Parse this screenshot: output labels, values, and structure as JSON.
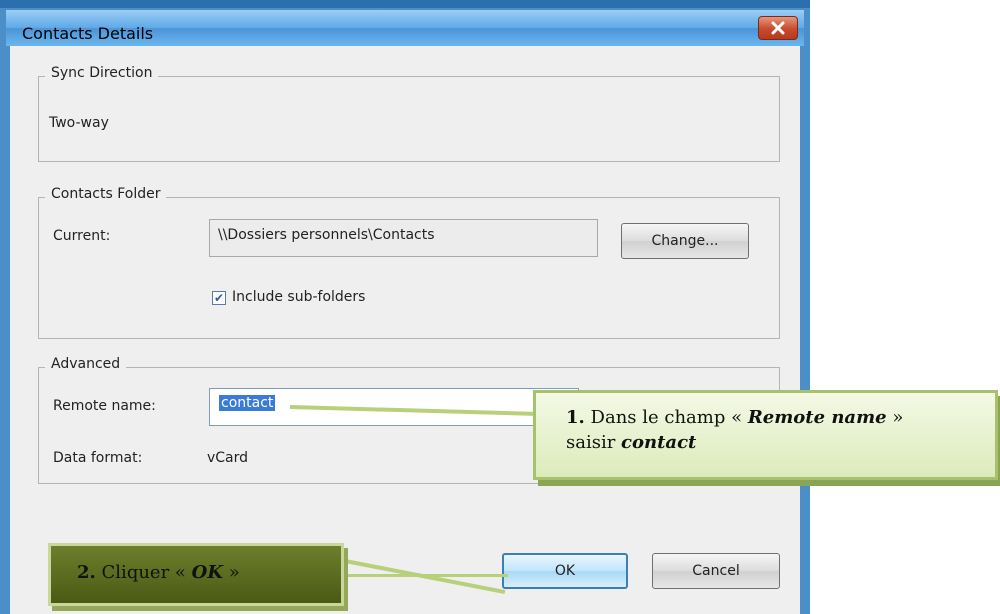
{
  "window": {
    "title": "Contacts Details",
    "close_symbol": "✕"
  },
  "sync_direction": {
    "legend": "Sync Direction",
    "value": "Two-way"
  },
  "contacts_folder": {
    "legend": "Contacts Folder",
    "current_label": "Current:",
    "current_value": "\\\\Dossiers personnels\\Contacts",
    "change_button": "Change...",
    "include_subfolders_label": "Include sub-folders",
    "include_subfolders_checked": true,
    "checkmark": "✔"
  },
  "advanced": {
    "legend": "Advanced",
    "remote_name_label": "Remote name:",
    "remote_name_value": "contact",
    "data_format_label": "Data format:",
    "data_format_value": "vCard"
  },
  "buttons": {
    "ok": "OK",
    "cancel": "Cancel"
  },
  "callouts": {
    "step1_number": "1.",
    "step1_text_a": "Dans le champ « ",
    "step1_emph": "Remote name",
    "step1_text_b": " »",
    "step1_line2_a": "saisir ",
    "step1_line2_emph": "contact",
    "step2_number": "2.",
    "step2_text_a": "Cliquer « ",
    "step2_emph": "OK",
    "step2_text_b": " »"
  }
}
